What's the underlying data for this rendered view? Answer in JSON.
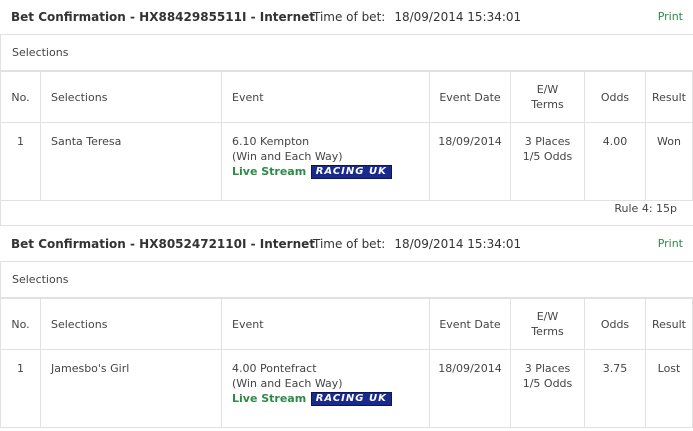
{
  "bets": [
    {
      "title": "Bet Confirmation  - HX8842985511I  - Internet",
      "time_label": "Time of bet:",
      "time_value": "18/09/2014 15:34:01",
      "print_label": "Print",
      "selections_label": "Selections",
      "columns": [
        "No.",
        "Selections",
        "Event",
        "Event Date",
        "E/W",
        "Terms",
        "Odds",
        "Result"
      ],
      "row": {
        "no": "1",
        "selection": "Santa Teresa",
        "event_line1": "6.10 Kempton",
        "event_line2": "(Win and Each Way)",
        "live_stream": "Live Stream",
        "racing_uk": "RACING UK",
        "date": "18/09/2014",
        "ew_line1": "3 Places",
        "ew_line2": "1/5  Odds",
        "odds": "4.00",
        "result": "Won"
      },
      "footer": "Rule 4: 15p"
    },
    {
      "title": "Bet Confirmation  - HX8052472110I  - Internet",
      "time_label": "Time of bet:",
      "time_value": "18/09/2014 15:34:01",
      "print_label": "Print",
      "selections_label": "Selections",
      "columns": [
        "No.",
        "Selections",
        "Event",
        "Event Date",
        "E/W",
        "Terms",
        "Odds",
        "Result"
      ],
      "row": {
        "no": "1",
        "selection": "Jamesbo's Girl",
        "event_line1": "4.00 Pontefract",
        "event_line2": "(Win and Each Way)",
        "live_stream": "Live Stream",
        "racing_uk": "RACING UK",
        "date": "18/09/2014",
        "ew_line1": "3 Places",
        "ew_line2": "1/5  Odds",
        "odds": "3.75",
        "result": "Lost"
      }
    }
  ],
  "colors": {
    "accent": "#2c8a46",
    "border": "#e1e1e1",
    "racing_uk_bg": "#1a2a8c"
  }
}
